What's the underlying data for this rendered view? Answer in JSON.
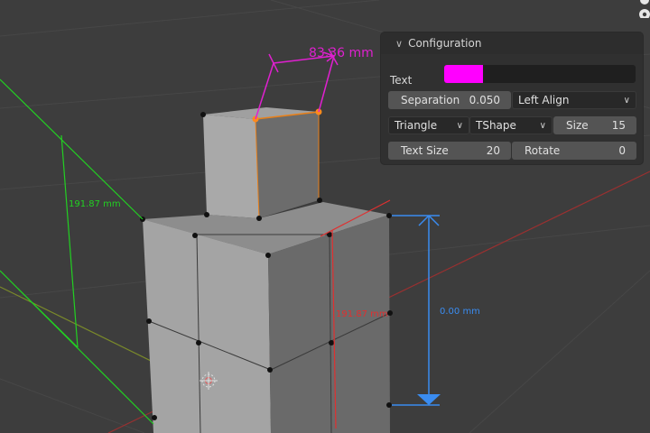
{
  "viewport": {
    "dimension_top": "83.36 mm",
    "dimension_left": "191.87 mm",
    "dimension_center": "191.87 mm",
    "dimension_right": "0.00 mm",
    "colors": {
      "background": "#3d3d3d",
      "magenta": "#e020d0",
      "green": "#22d022",
      "red": "#e03030",
      "blue": "#3a8cf0",
      "selection": "#e8801a"
    }
  },
  "panel": {
    "title": "Configuration",
    "text_label": "Text",
    "text_color": "#ff00ff",
    "separation_label": "Separation",
    "separation_value": "0.050",
    "align_value": "Left Align",
    "shape_value": "Triangle",
    "style_value": "TShape",
    "size_label": "Size",
    "size_value": "15",
    "text_size_label": "Text Size",
    "text_size_value": "20",
    "rotate_label": "Rotate",
    "rotate_value": "0"
  },
  "icons": {
    "collapse": "chevron-down-icon",
    "dropdown": "dropdown-arrow-icon",
    "corner": "camera-icon",
    "origin": "object-origin-icon"
  }
}
